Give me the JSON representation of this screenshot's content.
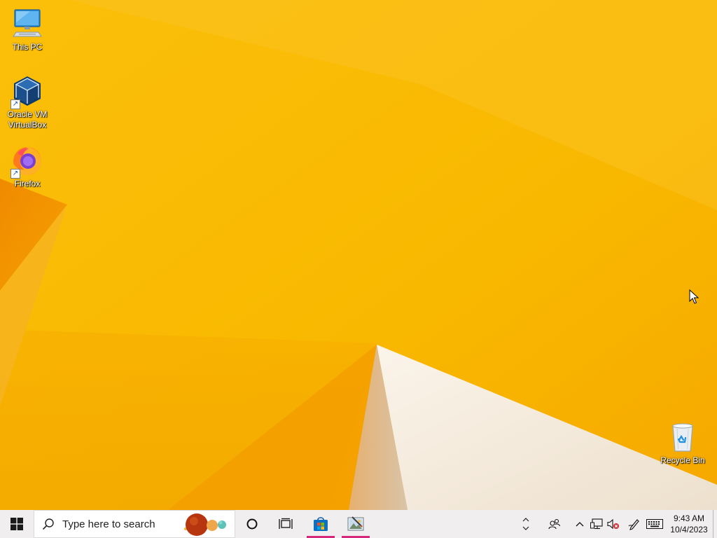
{
  "desktop": {
    "icons": [
      {
        "label": "This PC",
        "icon": "this-pc-icon"
      },
      {
        "label": "Oracle VM\nVirtualBox",
        "icon": "virtualbox-icon",
        "shortcut": true
      },
      {
        "label": "Firefox",
        "icon": "firefox-icon",
        "shortcut": true
      },
      {
        "label": "Recycle Bin",
        "icon": "recycle-bin-icon"
      }
    ],
    "wallpaper_colors": {
      "base": "#f7b500",
      "light": "#fbc520",
      "dark": "#f29a00",
      "pale": "#f3e6d6"
    }
  },
  "taskbar": {
    "start_icon": "windows-logo-icon",
    "search": {
      "placeholder": "Type here to search",
      "icon": "search-icon"
    },
    "cortana_icon": "cortana-circle-icon",
    "task_view_icon": "task-view-icon",
    "pinned_apps": [
      {
        "name": "Microsoft Store",
        "icon": "store-icon",
        "active": true
      },
      {
        "name": "Paint",
        "icon": "paint-icon",
        "active": true
      }
    ],
    "accent_color": "#d6287a",
    "tray": {
      "icons": [
        "people-icon",
        "show-hidden-icons-chevron",
        "network-icon",
        "volume-muted-icon",
        "pen-ink-icon",
        "touch-keyboard-icon"
      ],
      "time": "9:43 AM",
      "date": "10/4/2023"
    }
  }
}
